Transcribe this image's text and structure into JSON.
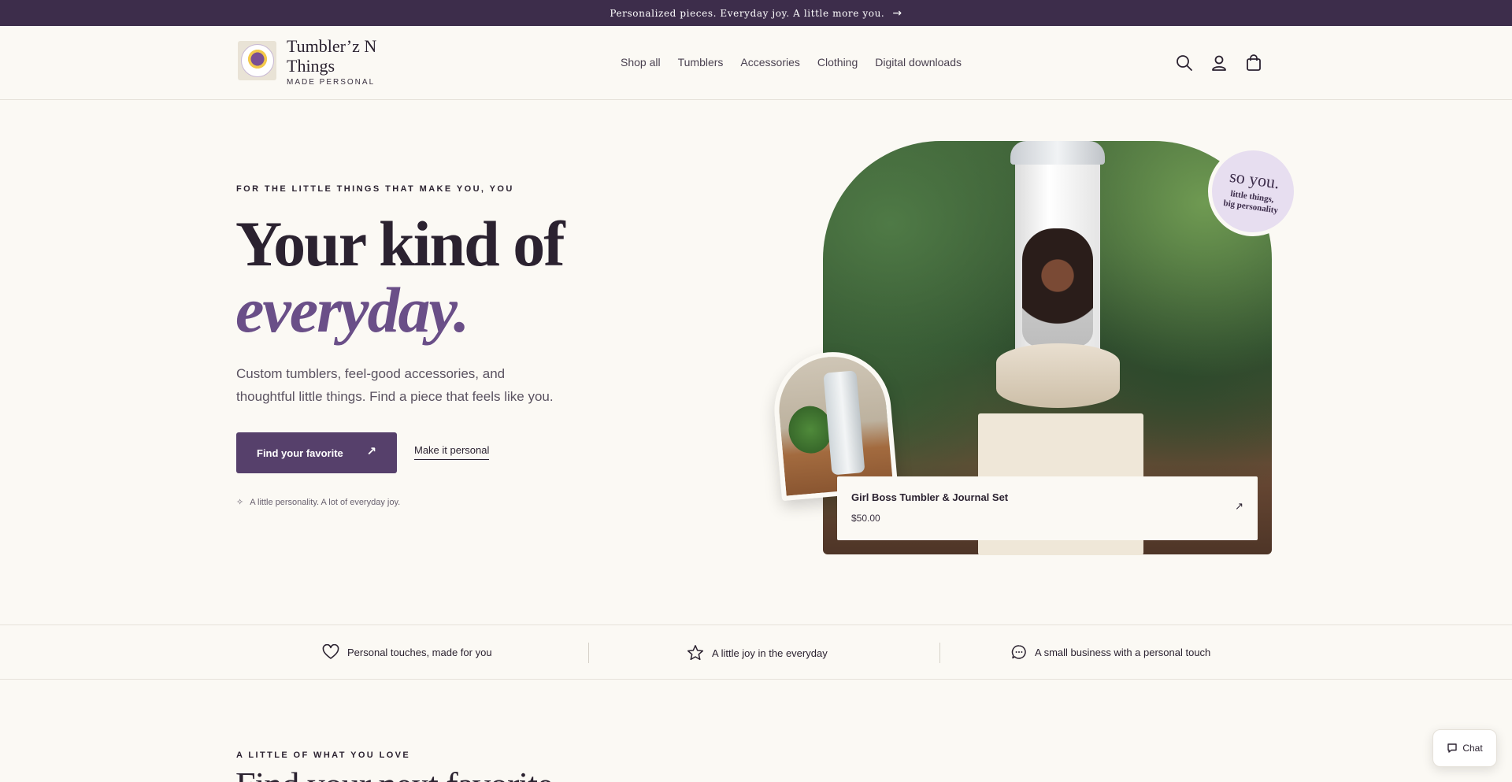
{
  "announcement": {
    "text": "Personalized pieces. Everyday joy. A little more you.",
    "arrow": "→"
  },
  "header": {
    "brand_name": "Tumbler’z N Things",
    "brand_tagline": "MADE PERSONAL",
    "nav": [
      "Shop all",
      "Tumblers",
      "Accessories",
      "Clothing",
      "Digital downloads"
    ],
    "icons": [
      "search-icon",
      "account-icon",
      "cart-icon"
    ]
  },
  "hero": {
    "eyebrow": "FOR THE LITTLE THINGS THAT MAKE YOU, YOU",
    "title_line1": "Your kind of",
    "title_line2": "everyday.",
    "subtitle": "Custom tumblers, feel-good accessories, and thoughtful little things. Find a piece that feels like you.",
    "primary_button": "Find your favorite",
    "primary_button_arrow": "↗",
    "secondary_link": "Make it personal",
    "note_icon": "✧",
    "note": "A little personality. A lot of everyday joy.",
    "sticker_big": "so you.",
    "sticker_small_1": "little things,",
    "sticker_small_2": "big personality",
    "featured": {
      "title": "Girl Boss Tumbler & Journal Set",
      "price": "$50.00",
      "arrow": "↗"
    }
  },
  "trust": [
    {
      "icon": "heart-icon",
      "text": "Personal touches, made for you"
    },
    {
      "icon": "star-icon",
      "text": "A little joy in the everyday"
    },
    {
      "icon": "chat-bubble-icon",
      "text": "A small business with a personal touch"
    }
  ],
  "section": {
    "eyebrow": "A LITTLE OF WHAT YOU LOVE",
    "title": "Find your next favorite"
  },
  "chat": {
    "label": "Chat"
  },
  "colors": {
    "primary": "#56406b",
    "announce_bg": "#3d2d4b",
    "accent_italic": "#6a4f88",
    "page_bg": "#fbf9f4"
  }
}
